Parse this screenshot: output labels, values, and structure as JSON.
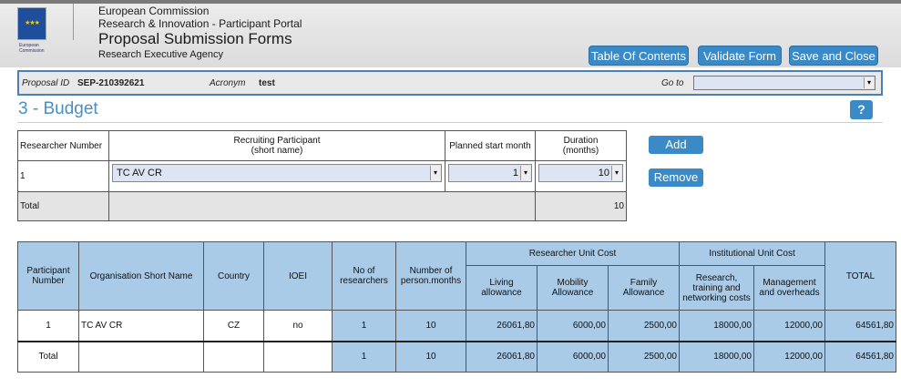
{
  "header": {
    "line1": "European Commission",
    "line2": "Research & Innovation - Participant Portal",
    "title": "Proposal Submission Forms",
    "agency": "Research Executive Agency",
    "logo_text_1": "European",
    "logo_text_2": "Commission",
    "buttons": {
      "toc": "Table Of Contents",
      "validate": "Validate Form",
      "save_close": "Save and Close"
    }
  },
  "infobar": {
    "proposal_id_label": "Proposal ID",
    "proposal_id_value": "SEP-210392621",
    "acronym_label": "Acronym",
    "acronym_value": "test",
    "goto_label": "Go to",
    "goto_value": ""
  },
  "section": {
    "title": "3 - Budget",
    "help": "?"
  },
  "recruit_table": {
    "headers": [
      "Researcher Number",
      "Recruiting Participant\n(short name)",
      "Planned start month",
      "Duration\n(months)"
    ],
    "row": {
      "number": "1",
      "participant": "TC AV CR",
      "start_month": "1",
      "duration": "10"
    },
    "total_label": "Total",
    "total_value": "10",
    "add_label": "Add",
    "remove_label": "Remove"
  },
  "budget_table": {
    "headers": {
      "participant_number": "Participant Number",
      "org_short_name": "Organisation Short Name",
      "country": "Country",
      "ioei": "IOEI",
      "no_researchers": "No of researchers",
      "person_months": "Number of person.months",
      "researcher_unit_cost": "Researcher Unit Cost",
      "living": "Living allowance",
      "mobility": "Mobility Allowance",
      "family": "Family Allowance",
      "institutional_unit_cost": "Institutional Unit Cost",
      "research_training": "Research, training and networking costs",
      "management": "Management and overheads",
      "total": "TOTAL"
    },
    "row": {
      "participant_number": "1",
      "org_short_name": "TC AV CR",
      "country": "CZ",
      "ioei": "no",
      "no_researchers": "1",
      "person_months": "10",
      "living": "26061,80",
      "mobility": "6000,00",
      "family": "2500,00",
      "research_training": "18000,00",
      "management": "12000,00",
      "total": "64561,80"
    },
    "total_row": {
      "label": "Total",
      "no_researchers": "1",
      "person_months": "10",
      "living": "26061,80",
      "mobility": "6000,00",
      "family": "2500,00",
      "research_training": "18000,00",
      "management": "12000,00",
      "total": "64561,80"
    }
  },
  "colors": {
    "accent": "#3a8ac7",
    "table_header": "#a9cbe7",
    "field_bg": "#dde4f4",
    "title": "#4a8ec4"
  }
}
